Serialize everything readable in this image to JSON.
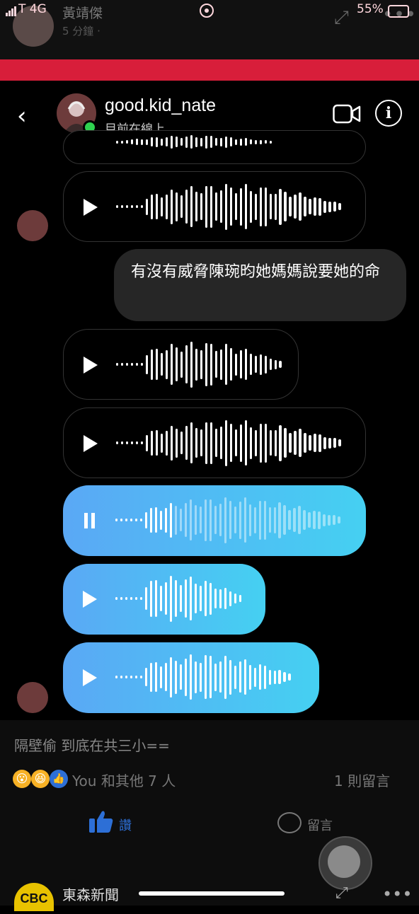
{
  "fb_top": {
    "poster_name": "黃靖傑",
    "post_time": "5 分鐘 ·",
    "more": "•••",
    "expand": "⤢"
  },
  "status_bar": {
    "carrier": "T  4G",
    "battery": "55%"
  },
  "chat_header": {
    "username": "good.kid_nate",
    "status": "目前在線上",
    "back": "‹",
    "info": "i"
  },
  "messages": {
    "text_message": "有沒有威脅陳琬昀她媽媽說要她的命",
    "voice_messages": [
      {
        "state": "play",
        "style": "received"
      },
      {
        "state": "play",
        "style": "received"
      },
      {
        "state": "play",
        "style": "received"
      },
      {
        "state": "pause",
        "style": "sent",
        "progress": 0.22
      },
      {
        "state": "play",
        "style": "sent"
      },
      {
        "state": "play",
        "style": "sent"
      }
    ]
  },
  "fb_post": {
    "caption": "隔壁偷 到底在共三小==",
    "reactions_text": "You 和其他 7 人",
    "comments_count": "1 則留言",
    "like_label": "讚",
    "comment_label": "留言",
    "next_post_page": "東森新聞",
    "next_post_logo": "CBC"
  },
  "colors": {
    "status_bar": "#d81e3a",
    "sent_bubble_start": "#5aa8f5",
    "sent_bubble_end": "#45d0f2",
    "online": "#2fd14f",
    "like_blue": "#2d6fd6"
  }
}
